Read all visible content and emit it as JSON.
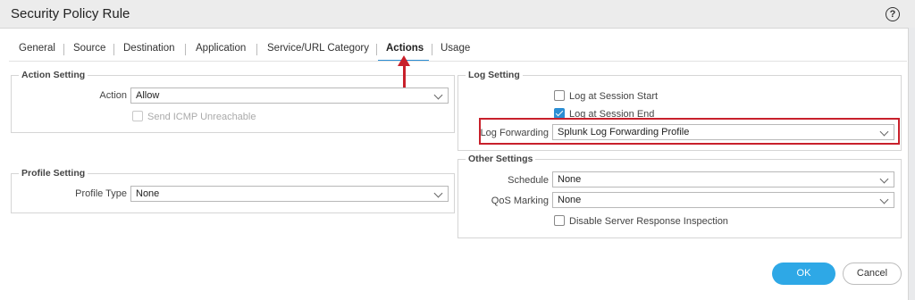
{
  "dialog": {
    "title": "Security Policy Rule"
  },
  "tabs": [
    {
      "label": "General"
    },
    {
      "label": "Source"
    },
    {
      "label": "Destination"
    },
    {
      "label": "Application"
    },
    {
      "label": "Service/URL Category"
    },
    {
      "label": "Actions"
    },
    {
      "label": "Usage"
    }
  ],
  "active_tab": "Actions",
  "action_setting": {
    "legend": "Action Setting",
    "action_label": "Action",
    "action_value": "Allow",
    "send_icmp_label": "Send ICMP Unreachable",
    "send_icmp_checked": false
  },
  "profile_setting": {
    "legend": "Profile Setting",
    "profile_type_label": "Profile Type",
    "profile_type_value": "None"
  },
  "log_setting": {
    "legend": "Log Setting",
    "log_start_label": "Log at Session Start",
    "log_start_checked": false,
    "log_end_label": "Log at Session End",
    "log_end_checked": true,
    "log_forwarding_label": "Log Forwarding",
    "log_forwarding_value": "Splunk Log Forwarding Profile"
  },
  "other_settings": {
    "legend": "Other Settings",
    "schedule_label": "Schedule",
    "schedule_value": "None",
    "qos_label": "QoS Marking",
    "qos_value": "None",
    "disable_sri_label": "Disable Server Response Inspection",
    "disable_sri_checked": false
  },
  "buttons": {
    "ok": "OK",
    "cancel": "Cancel"
  },
  "colors": {
    "accent": "#2b8ed4",
    "ok_button": "#2ea8e6",
    "annotation": "#c8202b"
  },
  "icons": {
    "help": "help-icon",
    "dropdown": "chevron-down-icon",
    "annotation_arrow": "arrow-up-icon"
  }
}
